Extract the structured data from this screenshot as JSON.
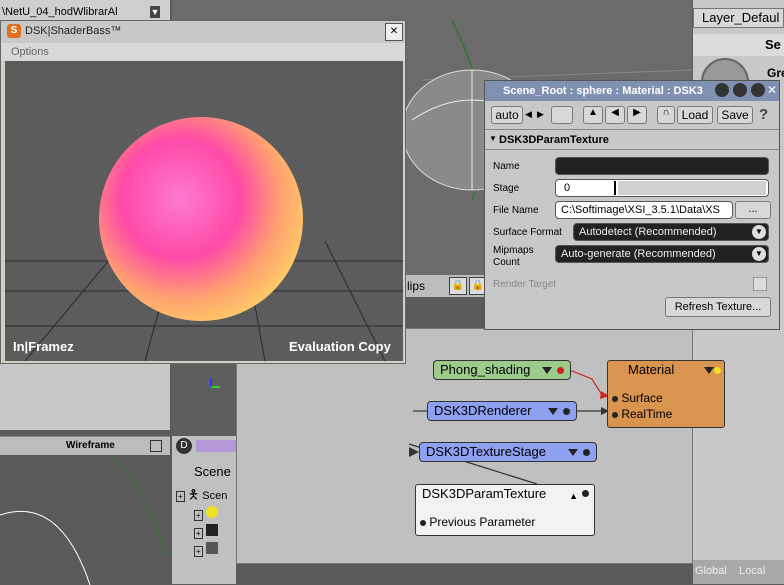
{
  "bg": {
    "top_left_tab": "\\NetU_04_hodWlibrarAl",
    "layer_default": "Layer_Defaul",
    "se_label": "Se",
    "gre_label": "Gre",
    "clips_label": "lips",
    "wireframe_label": "Wireframe",
    "scene_label": "Scene",
    "scene_sub": "Scen",
    "global_label": "Global",
    "local_label": "Local"
  },
  "shaderbass": {
    "title": "DSK|ShaderBass™",
    "menu": "Options",
    "close": "✕",
    "logo_left": "In|Framez",
    "logo_right": "Evaluation Copy"
  },
  "property": {
    "title": "Scene_Root : sphere : Material : DSK3",
    "toolbar": {
      "auto": "auto",
      "load": "Load",
      "save": "Save",
      "help": "?"
    },
    "section": "DSK3DParamTexture",
    "fields": {
      "name_label": "Name",
      "name_value": "",
      "stage_label": "Stage",
      "stage_value": "0",
      "filename_label": "File Name",
      "filename_value": "C:\\Softimage\\XSI_3.5.1\\Data\\XS",
      "browse": "...",
      "surface_format_label": "Surface Format",
      "surface_format_value": "Autodetect (Recommended)",
      "mipmaps_label_1": "Mipmaps",
      "mipmaps_label_2": "Count",
      "mipmaps_value": "Auto-generate (Recommended)",
      "render_target_label": "Render Target",
      "refresh": "Refresh Texture..."
    }
  },
  "render_tree": {
    "phong": "Phong_shading",
    "renderer": "DSK3DRenderer",
    "texture_stage": "DSK3DTextureStage",
    "param_texture": "DSK3DParamTexture",
    "previous_param": "Previous Parameter",
    "material": "Material",
    "surface": "Surface",
    "realtime": "RealTime"
  },
  "colors": {
    "phong": "#9ccc8c",
    "renderer": "#8ea0f0",
    "material": "#d9944f",
    "param": "#f2f2f2"
  }
}
